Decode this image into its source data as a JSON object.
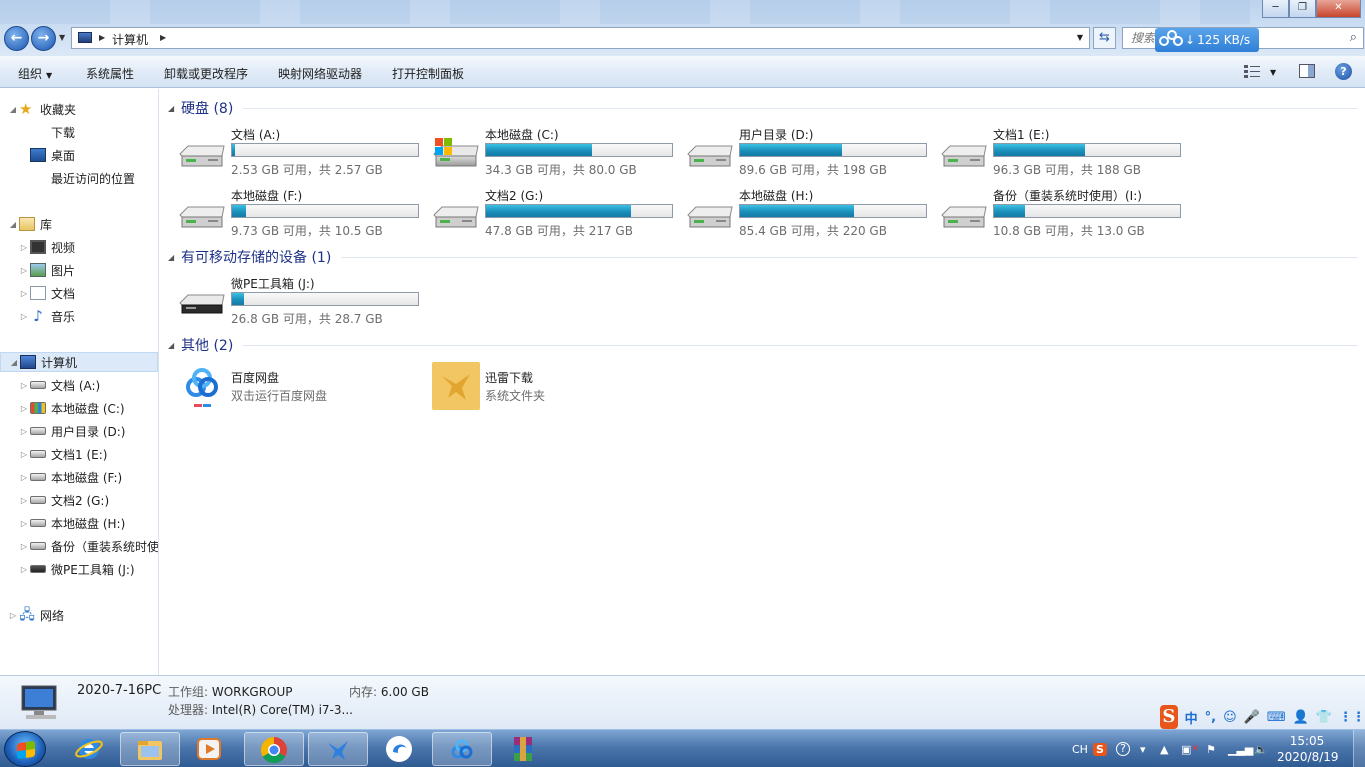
{
  "window": {
    "min_glyph": "─",
    "max_glyph": "❐",
    "close_glyph": "✕"
  },
  "address": {
    "path": "计算机",
    "search_placeholder": "搜索 计算机"
  },
  "net_speed": "125 KB/s",
  "toolbar": {
    "organize": "组织",
    "system_properties": "系统属性",
    "uninstall": "卸载或更改程序",
    "map_drive": "映射网络驱动器",
    "control_panel": "打开控制面板",
    "help": "?"
  },
  "sidebar": {
    "favorites": {
      "label": "收藏夹",
      "items": [
        "下载",
        "桌面",
        "最近访问的位置"
      ]
    },
    "libraries": {
      "label": "库",
      "items": [
        "视频",
        "图片",
        "文档",
        "音乐"
      ]
    },
    "computer": {
      "label": "计算机",
      "items": [
        "文档 (A:)",
        "本地磁盘 (C:)",
        "用户目录 (D:)",
        "文档1 (E:)",
        "本地磁盘 (F:)",
        "文档2 (G:)",
        "本地磁盘 (H:)",
        "备份（重装系统时使用）(I:)",
        "微PE工具箱 (J:)"
      ]
    },
    "network": "网络"
  },
  "groups": {
    "hdd": "硬盘 (8)",
    "removable": "有可移动存储的设备 (1)",
    "other": "其他 (2)"
  },
  "drives": [
    {
      "label": "文档 (A:)",
      "info": "2.53 GB 可用，共 2.57 GB",
      "used_fraction": 0.016
    },
    {
      "label": "本地磁盘 (C:)",
      "info": "34.3 GB 可用，共 80.0 GB",
      "used_fraction": 0.571
    },
    {
      "label": "用户目录 (D:)",
      "info": "89.6 GB 可用，共 198 GB",
      "used_fraction": 0.547
    },
    {
      "label": "文档1 (E:)",
      "info": "96.3 GB 可用，共 188 GB",
      "used_fraction": 0.488
    },
    {
      "label": "本地磁盘 (F:)",
      "info": "9.73 GB 可用，共 10.5 GB",
      "used_fraction": 0.073
    },
    {
      "label": "文档2 (G:)",
      "info": "47.8 GB 可用，共 217 GB",
      "used_fraction": 0.78
    },
    {
      "label": "本地磁盘 (H:)",
      "info": "85.4 GB 可用，共 220 GB",
      "used_fraction": 0.612
    },
    {
      "label": "备份（重装系统时使用）(I:)",
      "info": "10.8 GB 可用，共 13.0 GB",
      "used_fraction": 0.169
    }
  ],
  "removable": [
    {
      "label": "微PE工具箱 (J:)",
      "info": "26.8 GB 可用，共 28.7 GB",
      "used_fraction": 0.066
    }
  ],
  "other": [
    {
      "label": "百度网盘",
      "sub": "双击运行百度网盘"
    },
    {
      "label": "迅雷下载",
      "sub": "系统文件夹"
    }
  ],
  "details": {
    "name": "2020-7-16PC",
    "workgroup_key": "工作组:",
    "workgroup_val": "WORKGROUP",
    "memory_key": "内存:",
    "memory_val": "6.00 GB",
    "cpu_key": "处理器:",
    "cpu_val": "Intel(R) Core(TM) i7-3..."
  },
  "ime": {
    "items": [
      "中",
      "°,",
      "☺",
      "🎤",
      "⌨",
      "👤",
      "👕",
      "⋮⋮"
    ]
  },
  "tray": {
    "lang": "CH",
    "time": "15:05",
    "date": "2020/8/19"
  },
  "colors": {
    "bar_fill": "#1b8fbb",
    "group_header": "#1e3287",
    "taskbar": "#4c77ad"
  }
}
